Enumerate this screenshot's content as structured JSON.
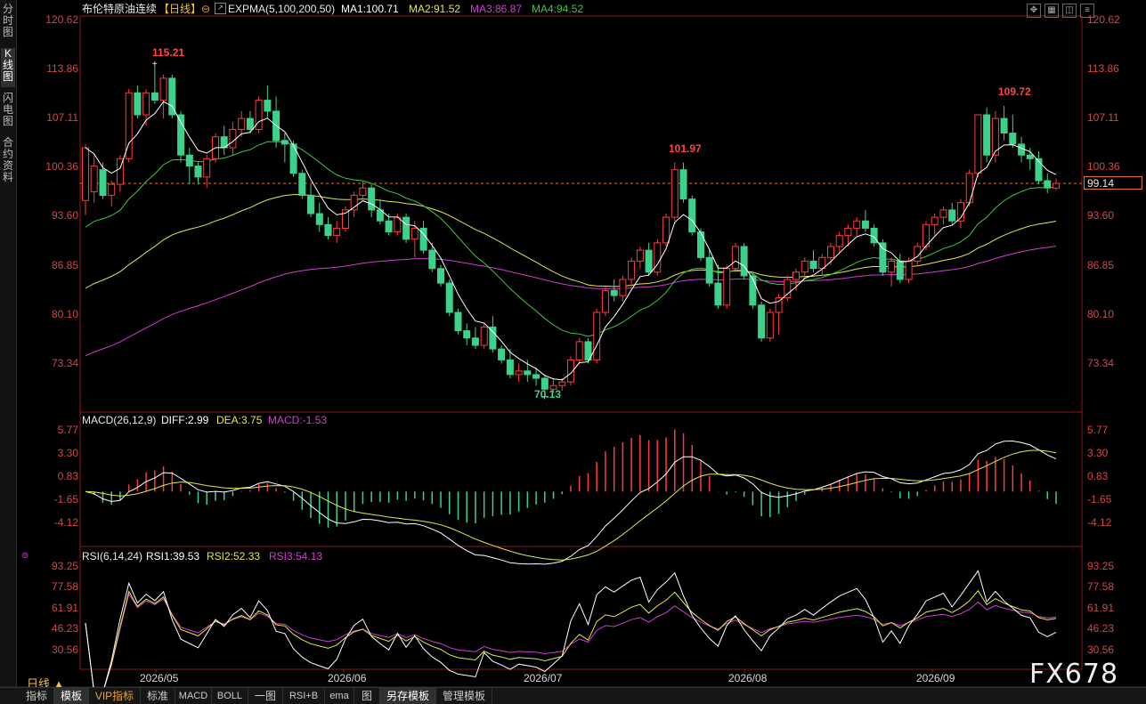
{
  "left_tabs": [
    "分时图",
    "K线图",
    "闪电图",
    "合约资料"
  ],
  "header": {
    "instrument": "布伦特原油连续",
    "period_bracket": "【日线】",
    "indicator": "EXPMA(5,100,200,50)",
    "ma1": "MA1:100.71",
    "ma2": "MA2:91.52",
    "ma3": "MA3:86.87",
    "ma4": "MA4:94.52"
  },
  "toolbar_icons": [
    "fit-icon",
    "grid-icon",
    "layout-icon",
    "menu-icon"
  ],
  "main_axis": {
    "labels": [
      "120.62",
      "113.86",
      "107.11",
      "100.36",
      "93.60",
      "86.85",
      "80.10",
      "73.34"
    ],
    "current_price": "99.14",
    "high_label": "115.21",
    "low_label": "70.13",
    "peak_label_jul": "101.97",
    "peak_label_sep": "109.72"
  },
  "macd": {
    "title": "MACD(26,12,9)",
    "diff": "DIFF:2.99",
    "dea": "DEA:3.75",
    "macd": "MACD:-1.53",
    "labels": [
      "5.77",
      "3.30",
      "0.83",
      "-1.65",
      "-4.12"
    ]
  },
  "rsi": {
    "title": "RSI(6,14,24)",
    "rsi1": "RSI1:39.53",
    "rsi2": "RSI2:52.33",
    "rsi3": "RSI3:54.13",
    "labels": [
      "93.25",
      "77.58",
      "61.91",
      "46.23",
      "30.56"
    ]
  },
  "date_labels": [
    "2026/05",
    "2026/06",
    "2026/07",
    "2026/08",
    "2026/09"
  ],
  "period_label": "日线",
  "bottom_tabs": [
    "指标",
    "模板",
    "VIP指标",
    "标准",
    "MACD",
    "BOLL",
    "一图",
    "RSI+B",
    "ema",
    "图",
    "另存模板",
    "管理模板"
  ],
  "watermark": "FX678",
  "colors": {
    "up": "#ff3c3c",
    "down": "#3cd28c",
    "ma1": "#ffffff",
    "ma2": "#e6e64a",
    "ma3": "#d23cd2",
    "ma4": "#3cc83c",
    "axis_text": "#d04848",
    "panel_border": "#8b1a1a"
  },
  "chart_data": {
    "type": "candlestick",
    "y_range": [
      68,
      122
    ],
    "candles": [
      [
        96.8,
        104.5,
        94.8,
        104
      ],
      [
        98,
        103,
        96.5,
        101.5
      ],
      [
        101,
        102,
        97,
        97.5
      ],
      [
        97.5,
        99.5,
        96,
        99
      ],
      [
        99,
        103,
        98,
        102.5
      ],
      [
        102.5,
        112,
        102,
        111.5
      ],
      [
        111.5,
        112.5,
        108,
        108.5
      ],
      [
        108.5,
        112,
        107,
        111.5
      ],
      [
        111.5,
        115.2,
        110,
        110.5
      ],
      [
        110.5,
        114,
        108,
        113.5
      ],
      [
        113.5,
        114,
        108,
        108.5
      ],
      [
        108.5,
        109,
        102,
        103
      ],
      [
        103,
        104,
        99,
        101.5
      ],
      [
        101.5,
        102,
        99,
        100
      ],
      [
        100,
        103,
        98.5,
        102.5
      ],
      [
        102.5,
        106,
        102,
        105.5
      ],
      [
        105.5,
        107,
        103,
        104
      ],
      [
        104,
        107.5,
        103,
        106.5
      ],
      [
        106.5,
        109,
        105.5,
        108
      ],
      [
        108,
        109,
        106,
        106.5
      ],
      [
        106.5,
        111,
        106,
        110.5
      ],
      [
        110.5,
        112.5,
        108,
        109
      ],
      [
        109,
        111,
        104,
        105
      ],
      [
        105,
        106,
        102,
        104.5
      ],
      [
        104.5,
        105,
        100,
        100.5
      ],
      [
        100.5,
        101,
        97,
        97.5
      ],
      [
        97.5,
        99,
        94.5,
        95
      ],
      [
        95,
        96.5,
        92.5,
        93.5
      ],
      [
        93.5,
        94.5,
        91.5,
        92
      ],
      [
        92,
        94,
        91,
        93
      ],
      [
        93,
        96,
        92.5,
        95.5
      ],
      [
        95.5,
        98,
        94.5,
        97.5
      ],
      [
        97.5,
        99.5,
        97,
        98.5
      ],
      [
        98.5,
        99,
        94.5,
        95.5
      ],
      [
        95.5,
        97,
        93.5,
        94
      ],
      [
        94,
        95,
        92,
        92.5
      ],
      [
        92.5,
        95,
        92,
        94.5
      ],
      [
        94.5,
        95,
        91,
        91.5
      ],
      [
        91.5,
        94,
        89,
        93
      ],
      [
        93,
        94,
        89.5,
        90
      ],
      [
        90,
        91,
        87,
        87.5
      ],
      [
        87.5,
        88,
        85,
        85.5
      ],
      [
        85.5,
        86,
        81,
        81.5
      ],
      [
        81.5,
        82,
        78.5,
        79
      ],
      [
        79,
        80,
        77,
        78
      ],
      [
        78,
        79.5,
        76.5,
        77
      ],
      [
        77,
        80,
        76.5,
        79.5
      ],
      [
        79.5,
        81,
        76,
        76.5
      ],
      [
        76.5,
        77,
        74.5,
        75
      ],
      [
        75,
        76.5,
        72.5,
        73
      ],
      [
        73,
        74.5,
        72,
        73.5
      ],
      [
        73.5,
        75,
        72,
        73
      ],
      [
        73,
        74,
        71.5,
        72.5
      ],
      [
        72.5,
        73,
        70.1,
        71
      ],
      [
        71,
        72.5,
        70.5,
        71.5
      ],
      [
        71.5,
        72.5,
        70.8,
        72
      ],
      [
        72,
        75.5,
        71.5,
        75
      ],
      [
        75,
        78,
        74.5,
        77.5
      ],
      [
        77.5,
        78,
        74.5,
        75
      ],
      [
        75,
        82,
        74.5,
        81.5
      ],
      [
        81.5,
        85,
        81,
        84.5
      ],
      [
        84.5,
        86,
        83,
        83.8
      ],
      [
        83.8,
        86.5,
        83,
        86
      ],
      [
        86,
        89,
        85,
        88.5
      ],
      [
        88.5,
        90.5,
        87.5,
        90
      ],
      [
        90,
        91,
        86.5,
        87
      ],
      [
        87,
        91.5,
        86.5,
        91
      ],
      [
        91,
        95,
        90.5,
        94.5
      ],
      [
        94.5,
        102,
        94,
        101
      ],
      [
        101,
        101.97,
        96.5,
        97
      ],
      [
        97,
        97.5,
        92,
        92.5
      ],
      [
        92.5,
        93,
        88.5,
        89
      ],
      [
        89,
        90,
        85,
        85.5
      ],
      [
        85.5,
        88,
        82,
        82.5
      ],
      [
        82.5,
        88,
        82,
        87.5
      ],
      [
        87.5,
        91,
        87,
        90.5
      ],
      [
        90.5,
        91,
        86,
        86.5
      ],
      [
        86.5,
        87,
        82,
        82.5
      ],
      [
        82.5,
        83,
        77.5,
        78
      ],
      [
        78,
        82,
        77.5,
        81.5
      ],
      [
        81.5,
        84,
        78.5,
        83.5
      ],
      [
        83.5,
        86.5,
        83,
        86
      ],
      [
        86,
        87.5,
        84.5,
        87
      ],
      [
        87,
        89,
        86,
        88.5
      ],
      [
        88.5,
        90,
        87,
        87.5
      ],
      [
        87.5,
        89.5,
        86.5,
        89
      ],
      [
        89,
        91,
        88,
        90.5
      ],
      [
        90.5,
        92.5,
        89.5,
        92
      ],
      [
        92,
        93.5,
        90.5,
        93
      ],
      [
        93,
        94.5,
        92,
        94
      ],
      [
        94,
        95.5,
        92.5,
        93
      ],
      [
        93,
        93.5,
        90.5,
        91
      ],
      [
        91,
        91.5,
        86.5,
        87
      ],
      [
        87,
        89,
        85,
        88.5
      ],
      [
        88.5,
        89.5,
        85.5,
        86
      ],
      [
        86,
        89,
        85.5,
        88.5
      ],
      [
        88.5,
        91,
        88,
        90.5
      ],
      [
        90.5,
        94,
        90,
        93.5
      ],
      [
        93.5,
        95,
        92,
        94.5
      ],
      [
        94.5,
        96,
        93.5,
        95.5
      ],
      [
        95.5,
        96.5,
        93.5,
        94
      ],
      [
        94,
        97,
        93,
        96.5
      ],
      [
        96.5,
        101,
        96,
        100.5
      ],
      [
        100.5,
        108.5,
        100,
        108.5
      ],
      [
        108.5,
        109.5,
        102,
        103
      ],
      [
        103,
        109,
        102,
        108
      ],
      [
        108,
        109.72,
        105,
        106
      ],
      [
        106,
        108.5,
        104,
        104.5
      ],
      [
        104.5,
        105.5,
        102,
        103
      ],
      [
        103,
        104,
        101,
        102.5
      ],
      [
        102.5,
        103.5,
        99,
        99.5
      ],
      [
        99.5,
        100.5,
        97.8,
        98.5
      ],
      [
        98.5,
        99.8,
        98.2,
        99.14
      ]
    ]
  }
}
